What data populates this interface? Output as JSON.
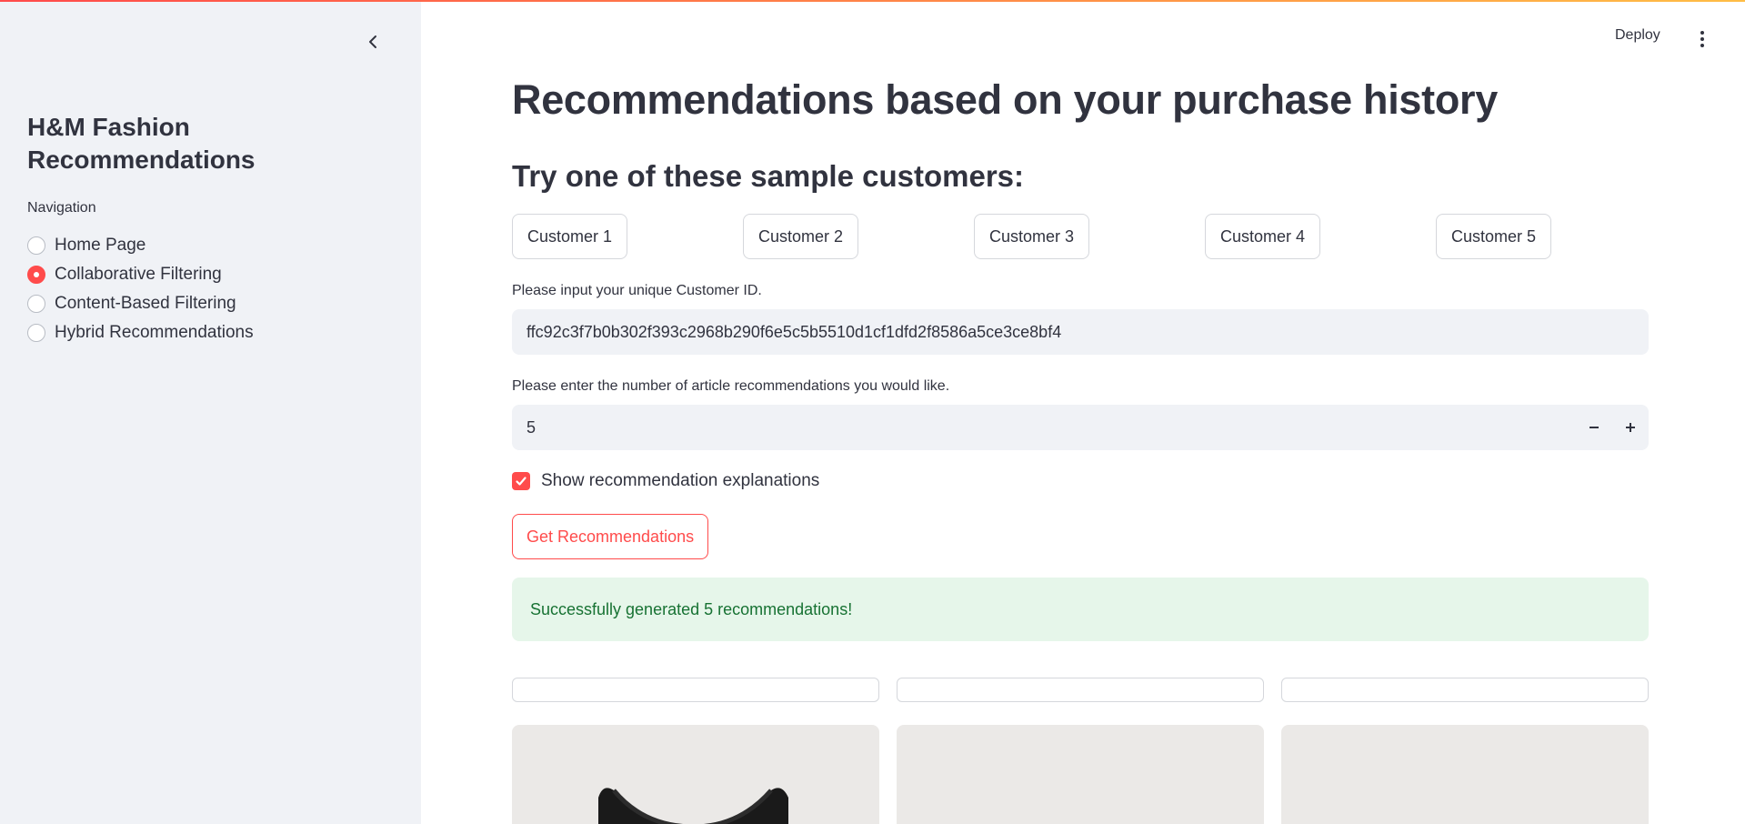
{
  "sidebar": {
    "title": "H&M Fashion Recommendations",
    "nav_label": "Navigation",
    "nav_options": [
      {
        "label": "Home Page",
        "selected": false
      },
      {
        "label": "Collaborative Filtering",
        "selected": true
      },
      {
        "label": "Content-Based Filtering",
        "selected": false
      },
      {
        "label": "Hybrid Recommendations",
        "selected": false
      }
    ]
  },
  "header": {
    "deploy_label": "Deploy"
  },
  "main": {
    "title": "Recommendations based on your purchase history",
    "subtitle": "Try one of these sample customers:",
    "sample_customers": [
      "Customer 1",
      "Customer 2",
      "Customer 3",
      "Customer 4",
      "Customer 5"
    ],
    "customer_id_label": "Please input your unique Customer ID.",
    "customer_id_value": "ffc92c3f7b0b302f393c2968b290f6e5c5b5510d1cf1dfd2f8586a5ce3ce8bf4",
    "num_recs_label": "Please enter the number of article recommendations you would like.",
    "num_recs_value": "5",
    "show_explanations_label": "Show recommendation explanations",
    "show_explanations_checked": true,
    "get_button_label": "Get Recommendations",
    "success_message": "Successfully generated 5 recommendations!"
  },
  "colors": {
    "accent": "#ff4b4b",
    "sidebar_bg": "#f0f2f6",
    "success_bg": "#e6f6ea",
    "success_text": "#177233"
  }
}
